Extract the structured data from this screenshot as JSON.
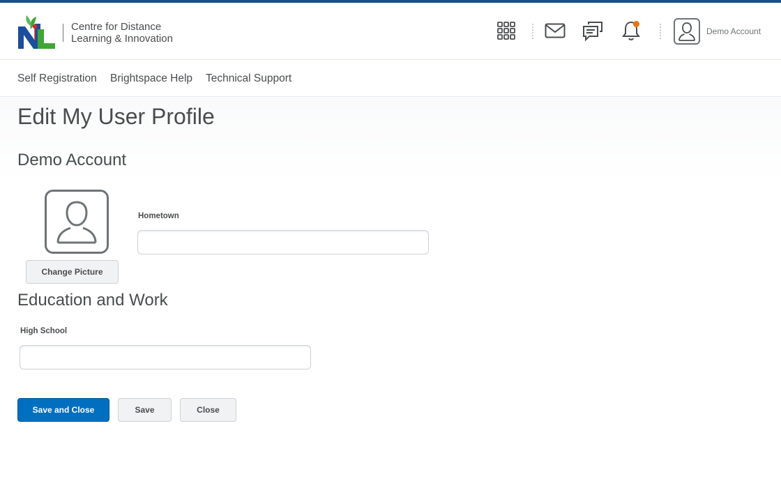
{
  "header": {
    "org_name_line1": "Centre for Distance",
    "org_name_line2": "Learning & Innovation",
    "account_name": "Demo Account",
    "icons": [
      "apps-grid-icon",
      "mail-icon",
      "chat-icon",
      "bell-icon",
      "user-avatar-icon"
    ],
    "notification_color": "#e87511"
  },
  "nav": {
    "items": [
      "Self Registration",
      "Brightspace Help",
      "Technical Support"
    ]
  },
  "page": {
    "title": "Edit My User Profile",
    "section_user": "Demo Account",
    "change_picture": "Change Picture",
    "hometown_label": "Hometown",
    "hometown_value": "",
    "section_education": "Education and Work",
    "high_school_label": "High School",
    "high_school_value": ""
  },
  "actions": {
    "save_close": "Save and Close",
    "save": "Save",
    "close": "Close"
  },
  "colors": {
    "primary": "#006fbf",
    "top_bar": "#1a4f8a",
    "text": "#494c4e"
  }
}
